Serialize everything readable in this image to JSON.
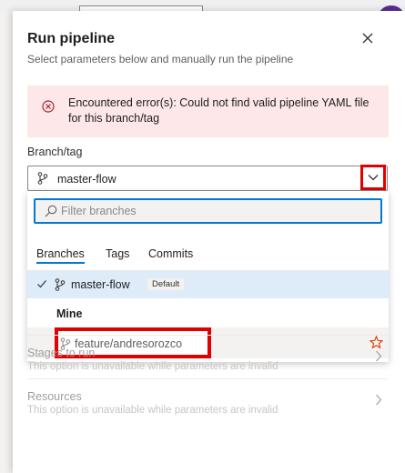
{
  "panel": {
    "title": "Run pipeline",
    "subtitle": "Select parameters below and manually run the pipeline"
  },
  "error": {
    "message": "Encountered error(s): Could not find valid pipeline YAML file for this branch/tag"
  },
  "branch": {
    "label": "Branch/tag",
    "value": "master-flow"
  },
  "dropdown": {
    "filter_placeholder": "Filter branches",
    "tabs": [
      {
        "label": "Branches",
        "active": true
      },
      {
        "label": "Tags",
        "active": false
      },
      {
        "label": "Commits",
        "active": false
      }
    ],
    "selected_branch": "master-flow",
    "selected_badge": "Default",
    "mine_header": "Mine",
    "mine_branch": "feature/andresorozco"
  },
  "sections": [
    {
      "title": "Stages to run",
      "description": "This option is unavailable while parameters are invalid"
    },
    {
      "title": "Resources",
      "description": "This option is unavailable while parameters are invalid"
    }
  ],
  "colors": {
    "accent": "#0078d4",
    "error_bg": "#fde7e9",
    "error_icon": "#a4262c",
    "highlight": "#e00000",
    "star": "#d83b01"
  }
}
